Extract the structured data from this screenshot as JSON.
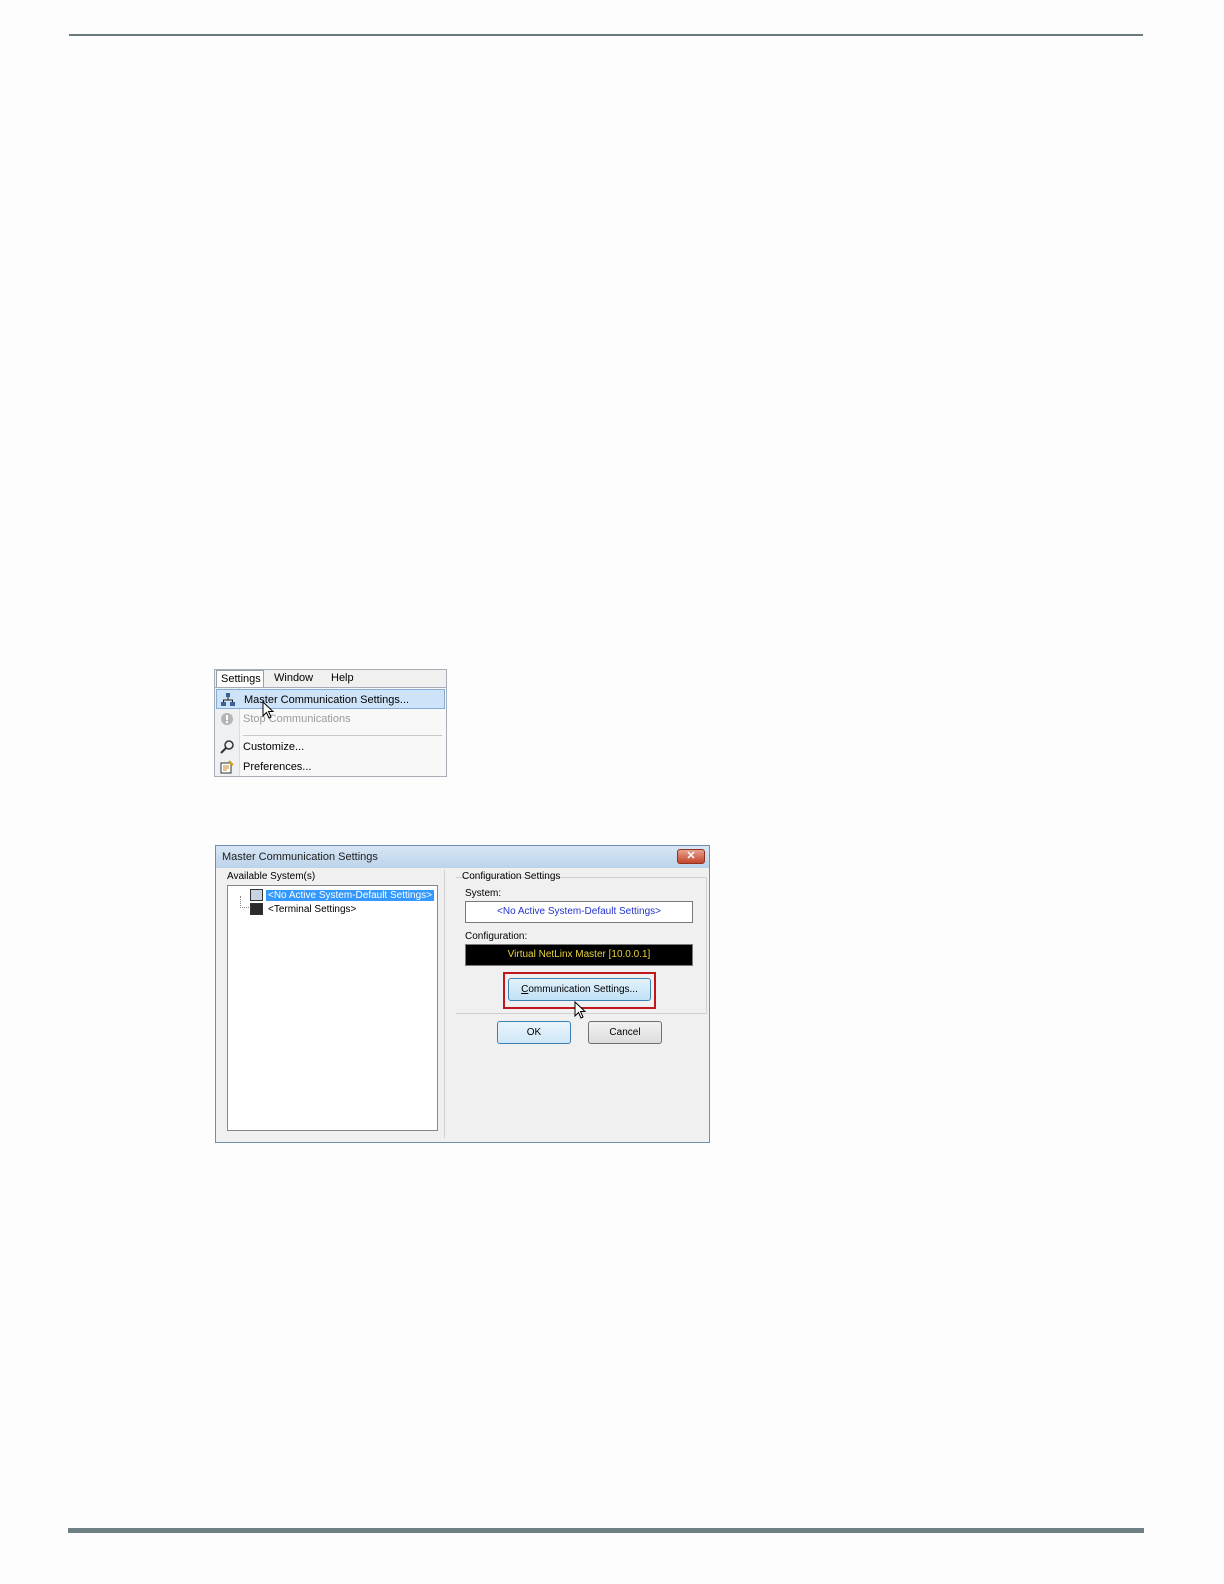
{
  "menu": {
    "bar": [
      "Settings",
      "Window",
      "Help"
    ],
    "items": [
      {
        "label": "Master Communication Settings...",
        "icon": "network-icon",
        "state": "highlighted"
      },
      {
        "label": "Stop Communications",
        "icon": "stop-icon",
        "state": "disabled"
      },
      {
        "label": "Customize...",
        "icon": "wrench-icon",
        "state": "normal"
      },
      {
        "label": "Preferences...",
        "icon": "preferences-icon",
        "state": "normal"
      }
    ]
  },
  "dialog": {
    "title": "Master Communication Settings",
    "available_label": "Available System(s)",
    "tree": [
      {
        "label": "<No Active System-Default Settings>",
        "selected": true
      },
      {
        "label": "<Terminal Settings>",
        "selected": false
      }
    ],
    "config_group_label": "Configuration Settings",
    "system_label": "System:",
    "system_value": "<No Active System-Default Settings>",
    "configuration_label": "Configuration:",
    "configuration_value": "Virtual NetLinx Master [10.0.0.1]",
    "comm_button_first": "C",
    "comm_button_rest": "ommunication Settings...",
    "ok_label": "OK",
    "cancel_label": "Cancel",
    "highlight_color": "#c0161e"
  }
}
